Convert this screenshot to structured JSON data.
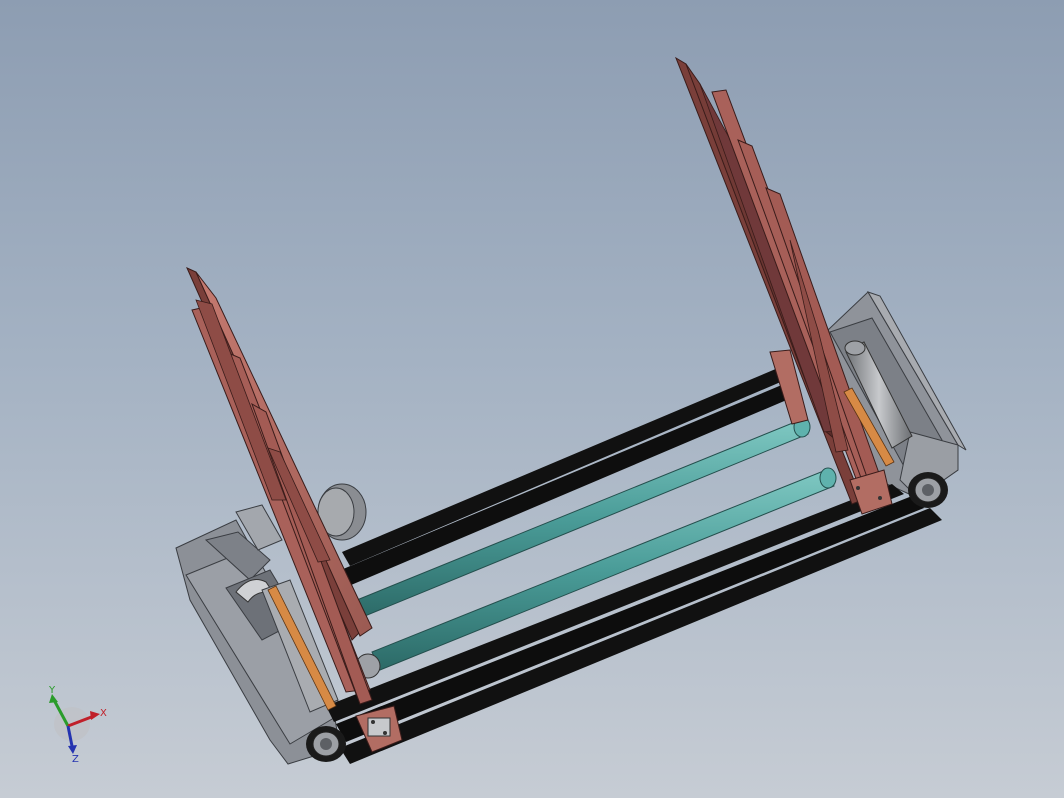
{
  "triad": {
    "x_label": "X",
    "y_label": "Y",
    "z_label": "Z"
  },
  "colors": {
    "plate": "#b06b62",
    "plate_dark": "#6e3a36",
    "belt": "#111111",
    "shaft": "#4a9c98",
    "frame": "#8e9299",
    "x_axis": "#c0202a",
    "y_axis": "#2a9c2a",
    "z_axis": "#2433b0"
  }
}
